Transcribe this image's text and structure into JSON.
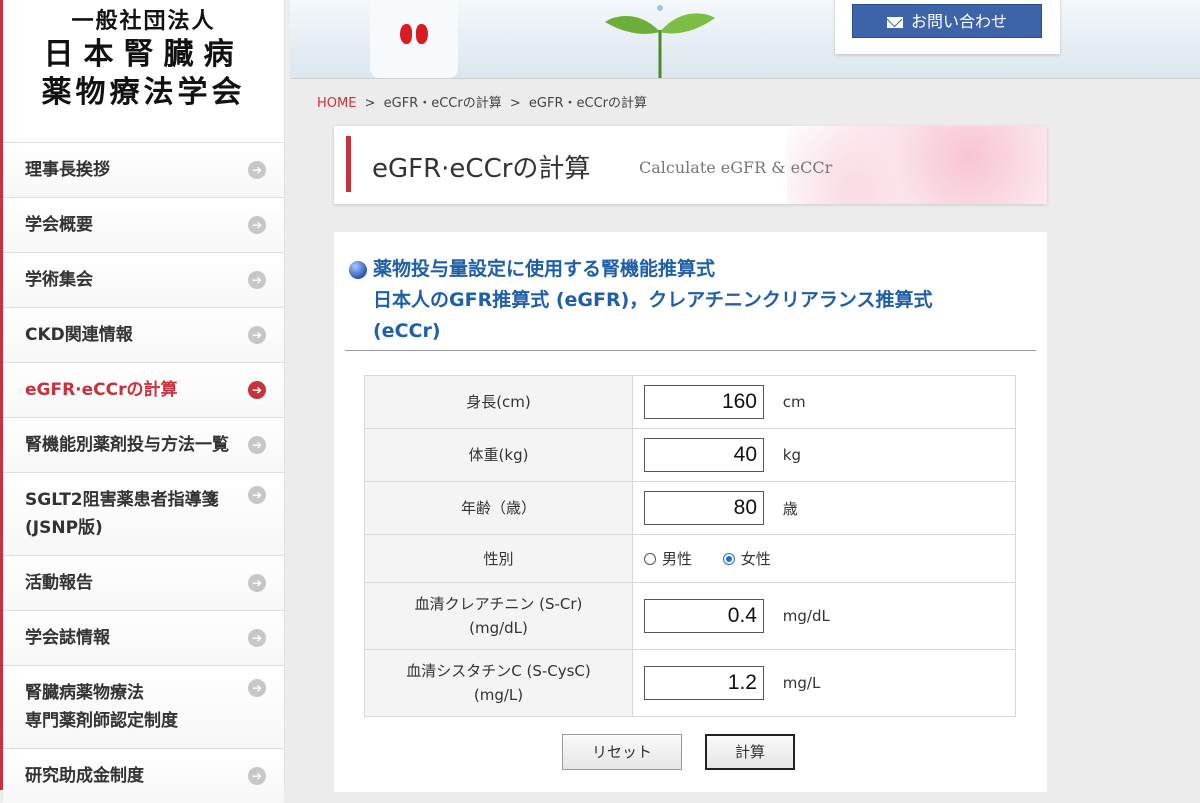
{
  "logo": {
    "line1": "一般社団法人",
    "line2": "日本腎臓病",
    "line3": "薬物療法学会"
  },
  "nav": {
    "items": [
      {
        "label": "理事長挨拶"
      },
      {
        "label": "学会概要"
      },
      {
        "label": "学術集会"
      },
      {
        "label": "CKD関連情報"
      },
      {
        "label": "eGFR·eCCrの計算",
        "active": true
      },
      {
        "label": "腎機能別薬剤投与方法一覧"
      },
      {
        "label_line1": "SGLT2阻害薬患者指導箋",
        "label_line2": "(JSNP版)"
      },
      {
        "label": "活動報告"
      },
      {
        "label": "学会誌情報"
      },
      {
        "label_line1": "腎臓病薬物療法",
        "label_line2": "専門薬剤師認定制度"
      },
      {
        "label": "研究助成金制度"
      }
    ],
    "arrow_glyph": "➔"
  },
  "header": {
    "contact_label": "お問い合わせ"
  },
  "breadcrumb": {
    "home": "HOME",
    "sep": ">",
    "item1": "eGFR・eCCrの計算",
    "item2": "eGFR・eCCrの計算"
  },
  "banner": {
    "title_jp": "eGFR·eCCrの計算",
    "title_en": "Calculate eGFR & eCCr"
  },
  "section": {
    "line1": "薬物投与量設定に使用する腎機能推算式",
    "line2": "日本人のGFR推算式 (eGFR)，クレアチニンクリアランス推算式",
    "line3": "(eCCr)"
  },
  "form": {
    "height": {
      "label": "身長(cm)",
      "value": "160",
      "unit": "cm"
    },
    "weight": {
      "label": "体重(kg)",
      "value": "40",
      "unit": "kg"
    },
    "age": {
      "label": "年齢（歳）",
      "value": "80",
      "unit": "歳"
    },
    "sex": {
      "label": "性別",
      "male": "男性",
      "female": "女性",
      "selected": "female"
    },
    "scr": {
      "label_line1": "血清クレアチニン (S-Cr)",
      "label_line2": "(mg/dL)",
      "value": "0.4",
      "unit": "mg/dL"
    },
    "cysc": {
      "label_line1": "血清シスタチンC (S-CysC)",
      "label_line2": "(mg/L)",
      "value": "1.2",
      "unit": "mg/L"
    }
  },
  "buttons": {
    "reset": "リセット",
    "calc": "計算"
  },
  "colors": {
    "accent_red": "#c8323c",
    "heading_blue": "#1f5fa8",
    "contact_blue": "#3d64ab"
  }
}
